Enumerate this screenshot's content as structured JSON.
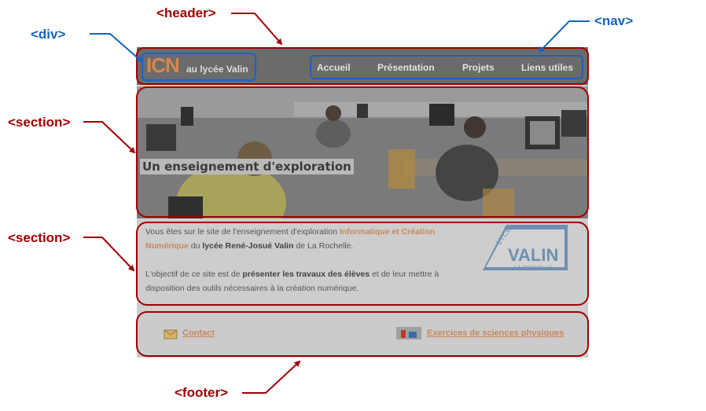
{
  "annotations": {
    "header": "<header>",
    "div": "<div>",
    "nav": "<nav>",
    "section_hero": "<section>",
    "section_intro": "<section>",
    "footer": "<footer>"
  },
  "site": {
    "logo": {
      "main": "ICN",
      "sub": "au lycée Valin"
    },
    "nav": [
      "Accueil",
      "Présentation",
      "Projets",
      "Liens utiles"
    ],
    "hero_caption": "Un enseignement d'exploration",
    "intro": {
      "p1_a": "Vous êtes sur le site de l'enseignement d'exploration ",
      "p1_b": "Informatique et Création Numérique",
      "p1_c": " du ",
      "p1_d": "lycée René-Josué Valin",
      "p1_e": " de La Rochelle.",
      "p2_a": "L'objectif de ce site est de ",
      "p2_b": "présenter les travaux des élèves",
      "p2_c": " et de leur mettre à disposition des outils nécessaires à la création numérique."
    },
    "lycee_logo": {
      "top": "LYCÉE",
      "name": "VALIN",
      "city": "LA ROCHELLE"
    },
    "footer": {
      "contact": "Contact",
      "exercices": "Exercices de sciences physiques"
    }
  },
  "colors": {
    "annotation_red": "#a00000",
    "annotation_blue": "#1565c0",
    "accent_orange": "#c9865a"
  }
}
